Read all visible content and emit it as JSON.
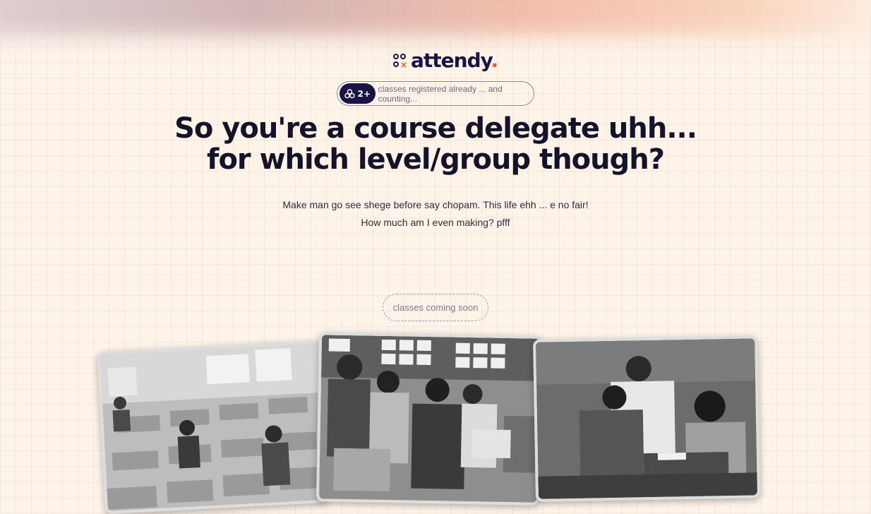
{
  "logo": {
    "text": "attendy",
    "dot": "."
  },
  "counter": {
    "count": "2+",
    "text": "classes registered already ... and counting..."
  },
  "headline": {
    "line1": "So you're a course delegate uhh...",
    "line2": "for which level/group though?"
  },
  "subtext": {
    "line1": "Make man go see shege before say chopam. This life ehh ... e no fair!",
    "line2": "How much am I even making? pfff"
  },
  "status": {
    "label": "classes coming soon"
  },
  "colors": {
    "navy": "#1a1446",
    "accent": "#ef5a2a",
    "background": "#fdf3e9"
  },
  "icons": {
    "badge": "people-icon"
  }
}
